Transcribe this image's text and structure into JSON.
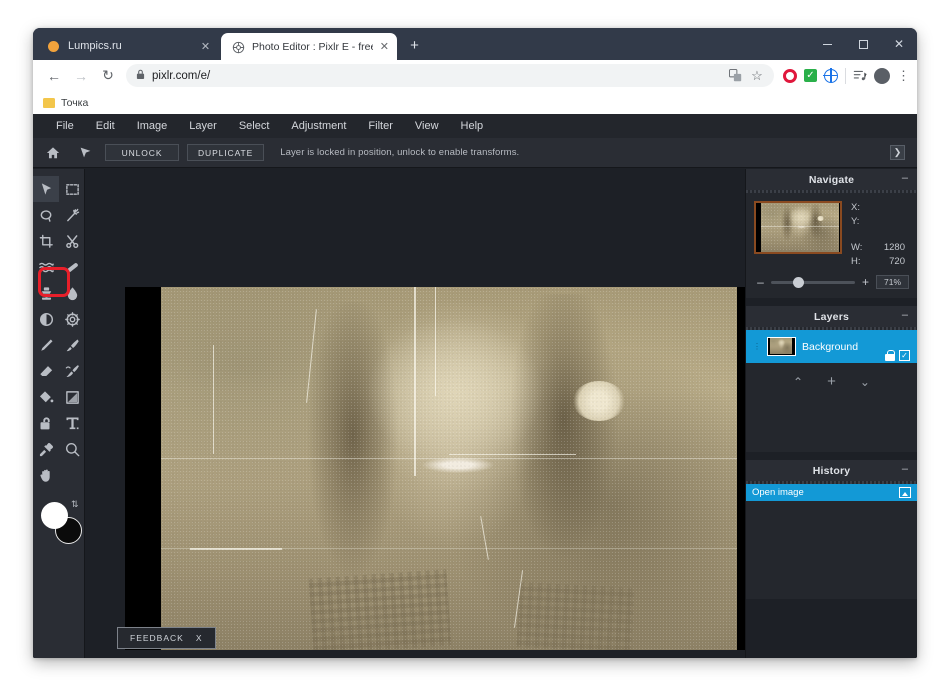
{
  "browser": {
    "tabs": [
      {
        "title": "Lumpics.ru",
        "favicon": "orange-circle-icon",
        "close": "✕",
        "active": false
      },
      {
        "title": "Photo Editor : Pixlr E - free image",
        "favicon": "pixlr-icon",
        "close": "✕",
        "active": true
      }
    ],
    "new_tab_label": "+",
    "window_controls": {
      "minimize": "minimize-icon",
      "maximize": "maximize-icon",
      "close": "✕"
    },
    "nav": {
      "back": "←",
      "forward": "→",
      "reload": "↻",
      "lock": "🔒",
      "url": "pixlr.com/e/",
      "translate": "translate-icon",
      "bookmark_star": "☆"
    },
    "extensions": [
      {
        "name": "opera-extension-icon"
      },
      {
        "name": "green-check-extension-icon"
      },
      {
        "name": "blue-globe-extension-icon"
      }
    ],
    "reading_list": "reading-list-icon",
    "profile": "avatar",
    "menu": "⋮",
    "bookmarks": [
      {
        "label": "Точка",
        "icon": "folder-icon"
      }
    ]
  },
  "app": {
    "menubar": [
      "File",
      "Edit",
      "Image",
      "Layer",
      "Select",
      "Adjustment",
      "Filter",
      "View",
      "Help"
    ],
    "options_bar": {
      "home_icon": "home-icon",
      "cursor_icon": "arrow-tool-icon",
      "unlock_label": "UNLOCK",
      "duplicate_label": "DUPLICATE",
      "note": "Layer is locked in position, unlock to enable transforms.",
      "collapse_label": "❯"
    },
    "tools": [
      {
        "name": "arrange-tool",
        "icon": "arrow-cursor-icon",
        "active": true
      },
      {
        "name": "marquee-select-tool",
        "icon": "marquee-icon",
        "active": false
      },
      {
        "name": "lasso-select-tool",
        "icon": "lasso-icon",
        "active": false
      },
      {
        "name": "magic-wand-tool",
        "icon": "magic-wand-icon",
        "active": false
      },
      {
        "name": "crop-tool",
        "icon": "crop-icon",
        "active": false
      },
      {
        "name": "cutout-tool",
        "icon": "scissors-icon",
        "active": false
      },
      {
        "name": "liquify-tool",
        "icon": "liquify-wave-icon",
        "active": false
      },
      {
        "name": "heal-tool",
        "icon": "bandage-icon",
        "active": false
      },
      {
        "name": "clone-stamp-tool",
        "icon": "clone-stamp-icon",
        "active": false,
        "highlighted": true
      },
      {
        "name": "blur-tool",
        "icon": "water-drop-icon",
        "active": false
      },
      {
        "name": "dodge-burn-tool",
        "icon": "dodge-burn-icon",
        "active": false
      },
      {
        "name": "sharpen-tool",
        "icon": "gear-sharpen-icon",
        "active": false
      },
      {
        "name": "pencil-tool",
        "icon": "pencil-icon",
        "active": false
      },
      {
        "name": "brush-tool",
        "icon": "paintbrush-icon",
        "active": false
      },
      {
        "name": "eraser-tool",
        "icon": "eraser-icon",
        "active": false
      },
      {
        "name": "detail-brush-tool",
        "icon": "detail-brush-icon",
        "active": false
      },
      {
        "name": "paint-bucket-tool",
        "icon": "paint-bucket-icon",
        "active": false
      },
      {
        "name": "gradient-tool",
        "icon": "gradient-square-icon",
        "active": false
      },
      {
        "name": "shape-tool",
        "icon": "shape-lock-icon",
        "active": false
      },
      {
        "name": "text-tool",
        "icon": "text-t-icon",
        "active": false
      },
      {
        "name": "color-picker-tool",
        "icon": "eyedropper-icon",
        "active": false
      },
      {
        "name": "zoom-tool",
        "icon": "magnifier-icon",
        "active": false
      },
      {
        "name": "hand-tool",
        "icon": "hand-icon",
        "active": false
      }
    ],
    "swatches": {
      "foreground": "#ffffff",
      "background": "#0b0b0b",
      "swap_icon": "swap-arrows-icon"
    },
    "feedback": {
      "label": "FEEDBACK",
      "close": "X"
    },
    "panels": {
      "navigate": {
        "title": "Navigate",
        "minimize": "–",
        "fields": [
          {
            "key": "X:",
            "value": ""
          },
          {
            "key": "Y:",
            "value": ""
          },
          {
            "key": "W:",
            "value": "1280"
          },
          {
            "key": "H:",
            "value": "720"
          }
        ],
        "zoom_minus": "–",
        "zoom_plus": "+",
        "zoom_value": "71%"
      },
      "layers": {
        "title": "Layers",
        "minimize": "–",
        "items": [
          {
            "name": "Background",
            "locked": true,
            "visible": true,
            "lock_icon": "lock-icon",
            "visible_icon": "checkbox-icon"
          }
        ],
        "actions": {
          "up": "⌃",
          "add": "+",
          "down": "⌄"
        }
      },
      "history": {
        "title": "History",
        "minimize": "–",
        "items": [
          {
            "label": "Open image",
            "icon": "image-icon"
          }
        ]
      }
    }
  },
  "colors": {
    "accent_blue": "#1399d6",
    "highlight_red": "#e81f2a",
    "panel_bg": "#24272d",
    "app_bg": "#1d2026",
    "chrome_bg": "#323a49"
  }
}
